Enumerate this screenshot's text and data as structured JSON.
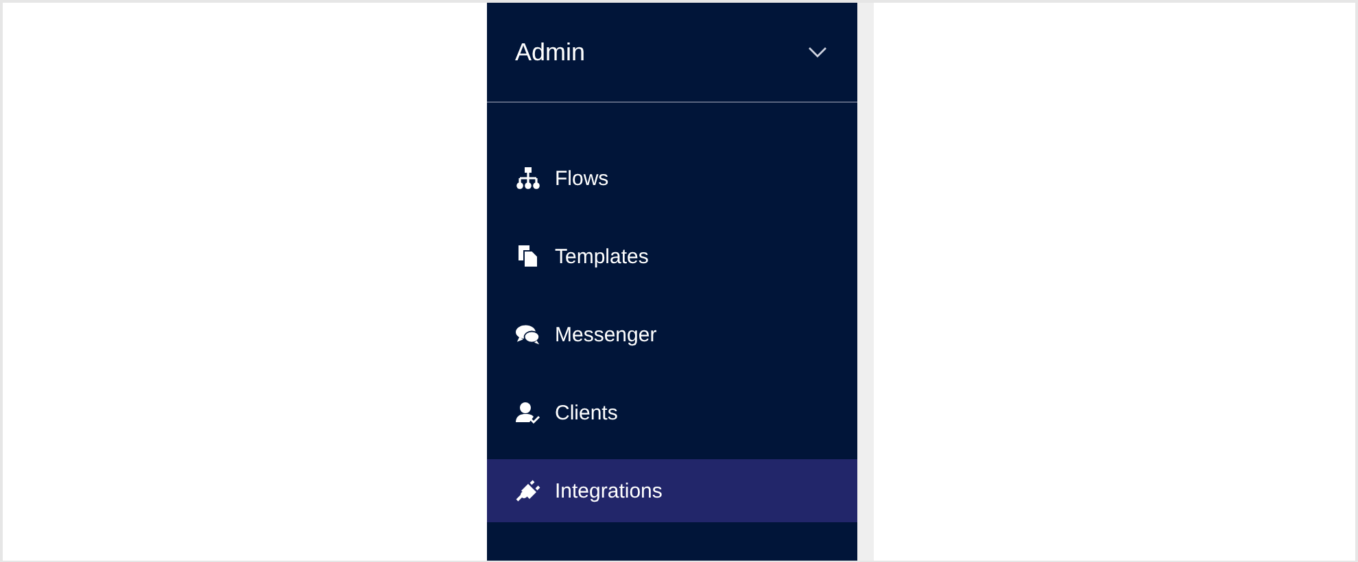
{
  "sidebar": {
    "header": {
      "title": "Admin",
      "expanded": true
    },
    "items": [
      {
        "label": "Flows",
        "selected": false
      },
      {
        "label": "Templates",
        "selected": false
      },
      {
        "label": "Messenger",
        "selected": false
      },
      {
        "label": "Clients",
        "selected": false
      },
      {
        "label": "Integrations",
        "selected": true
      }
    ]
  }
}
